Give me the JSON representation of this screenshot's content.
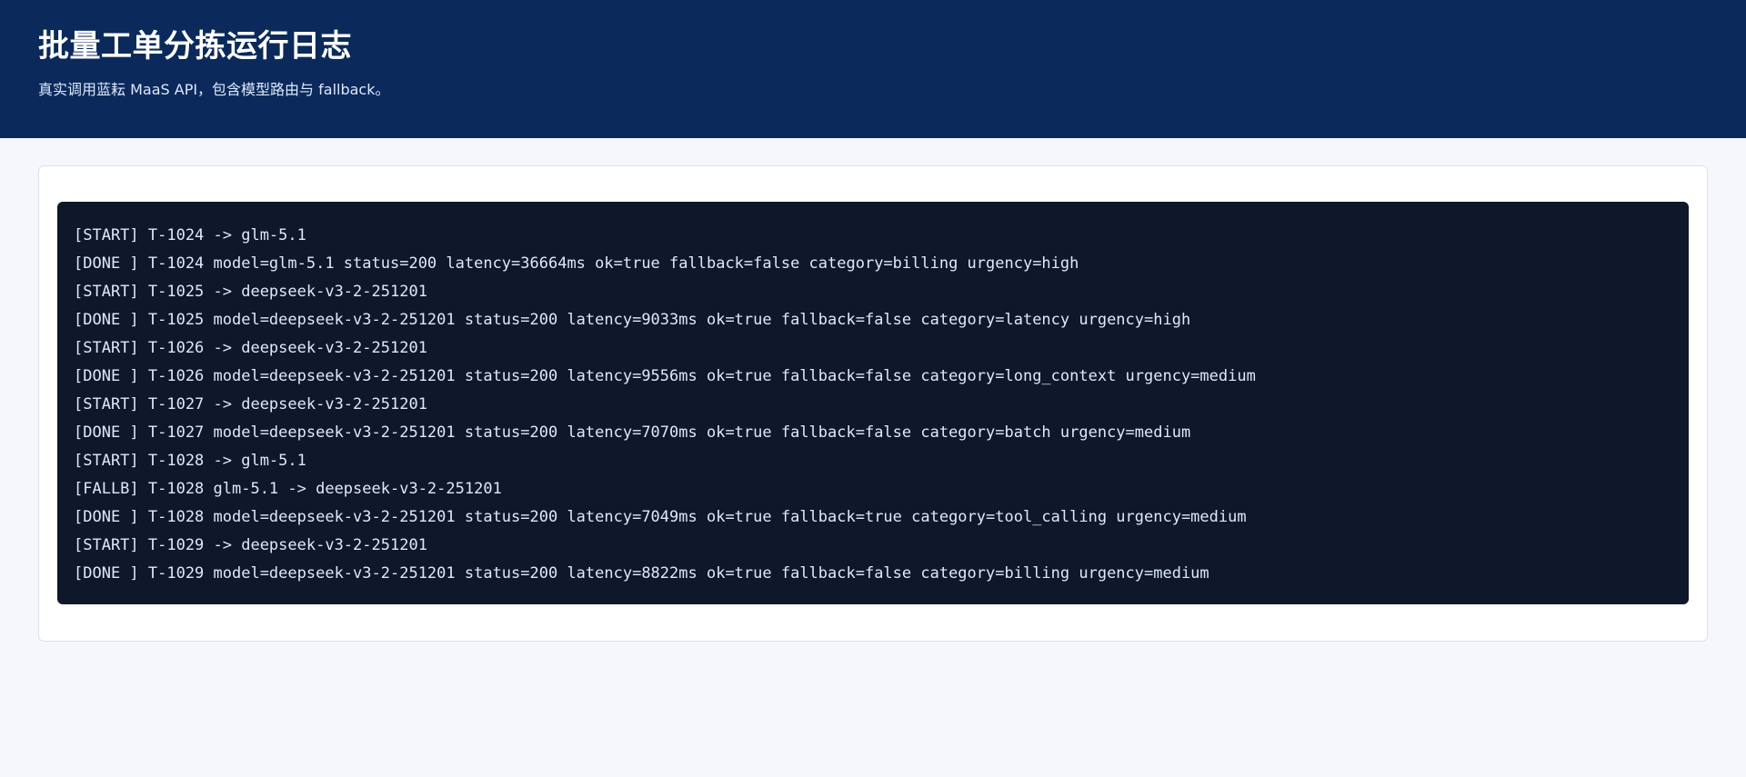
{
  "header": {
    "title": "批量工单分拣运行日志",
    "subtitle": "真实调用蓝耘 MaaS API，包含模型路由与 fallback。"
  },
  "log": {
    "lines": [
      "[START] T-1024 -> glm-5.1",
      "[DONE ] T-1024 model=glm-5.1 status=200 latency=36664ms ok=true fallback=false category=billing urgency=high",
      "[START] T-1025 -> deepseek-v3-2-251201",
      "[DONE ] T-1025 model=deepseek-v3-2-251201 status=200 latency=9033ms ok=true fallback=false category=latency urgency=high",
      "[START] T-1026 -> deepseek-v3-2-251201",
      "[DONE ] T-1026 model=deepseek-v3-2-251201 status=200 latency=9556ms ok=true fallback=false category=long_context urgency=medium",
      "[START] T-1027 -> deepseek-v3-2-251201",
      "[DONE ] T-1027 model=deepseek-v3-2-251201 status=200 latency=7070ms ok=true fallback=false category=batch urgency=medium",
      "[START] T-1028 -> glm-5.1",
      "[FALLB] T-1028 glm-5.1 -> deepseek-v3-2-251201",
      "[DONE ] T-1028 model=deepseek-v3-2-251201 status=200 latency=7049ms ok=true fallback=true category=tool_calling urgency=medium",
      "[START] T-1029 -> deepseek-v3-2-251201",
      "[DONE ] T-1029 model=deepseek-v3-2-251201 status=200 latency=8822ms ok=true fallback=false category=billing urgency=medium"
    ]
  },
  "colors": {
    "header_bg": "#0b2a5b",
    "page_bg": "#f5f7fb",
    "terminal_bg": "#0f172a",
    "terminal_text": "#dbeafe"
  }
}
